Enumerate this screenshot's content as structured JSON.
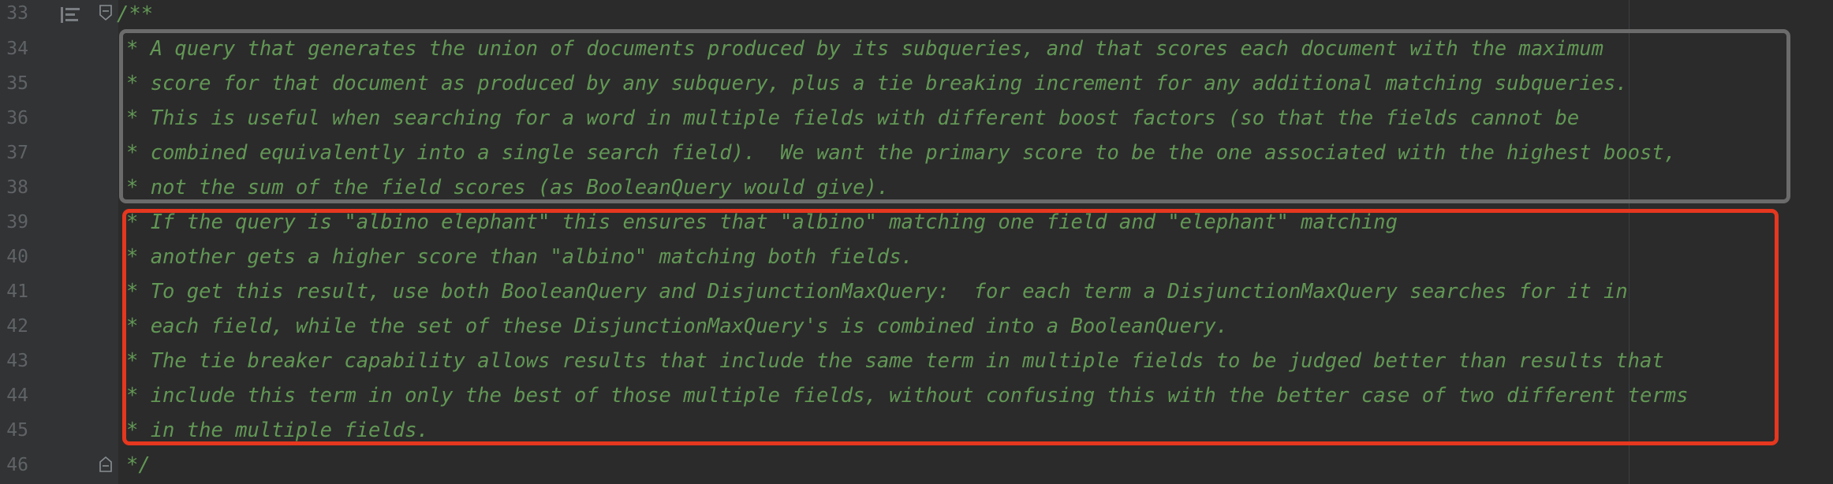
{
  "editor": {
    "lines": [
      {
        "number": "33",
        "text": "/**"
      },
      {
        "number": "34",
        "text": "* A query that generates the union of documents produced by its subqueries, and that scores each document with the maximum"
      },
      {
        "number": "35",
        "text": "* score for that document as produced by any subquery, plus a tie breaking increment for any additional matching subqueries."
      },
      {
        "number": "36",
        "text": "* This is useful when searching for a word in multiple fields with different boost factors (so that the fields cannot be"
      },
      {
        "number": "37",
        "text": "* combined equivalently into a single search field).  We want the primary score to be the one associated with the highest boost,"
      },
      {
        "number": "38",
        "text": "* not the sum of the field scores (as BooleanQuery would give)."
      },
      {
        "number": "39",
        "text": "* If the query is \"albino elephant\" this ensures that \"albino\" matching one field and \"elephant\" matching"
      },
      {
        "number": "40",
        "text": "* another gets a higher score than \"albino\" matching both fields."
      },
      {
        "number": "41",
        "text": "* To get this result, use both BooleanQuery and DisjunctionMaxQuery:  for each term a DisjunctionMaxQuery searches for it in"
      },
      {
        "number": "42",
        "text": "* each field, while the set of these DisjunctionMaxQuery's is combined into a BooleanQuery."
      },
      {
        "number": "43",
        "text": "* The tie breaker capability allows results that include the same term in multiple fields to be judged better than results that"
      },
      {
        "number": "44",
        "text": "* include this term in only the best of those multiple fields, without confusing this with the better case of two different terms"
      },
      {
        "number": "45",
        "text": "* in the multiple fields."
      },
      {
        "number": "46",
        "text": "*/"
      }
    ]
  },
  "icons": {
    "gutter_marker": "implementation-marker-icon",
    "fold_start": "fold-start-icon",
    "fold_end": "fold-end-icon"
  },
  "colors": {
    "background": "#2b2b2b",
    "gutter": "#313335",
    "line_number": "#606366",
    "comment_text": "#629755",
    "gray_highlight": "#6b6b6b",
    "red_highlight": "#e6371f"
  }
}
